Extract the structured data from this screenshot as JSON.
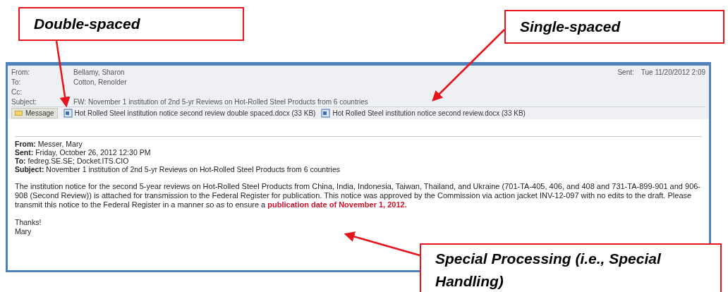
{
  "callouts": [
    {
      "text": "Double-spaced"
    },
    {
      "text": "Single-spaced"
    },
    {
      "text": "Special Processing (i.e., Special Handling)"
    }
  ],
  "email": {
    "header": [
      {
        "label": "From:",
        "value": "Bellamy, Sharon"
      },
      {
        "label": "To:",
        "value": "Cotton, Renolder"
      },
      {
        "label": "Cc:"
      },
      {
        "label": "Subject:",
        "value": "FW: November 1 institution of 2nd 5-yr Reviews on Hot-Rolled Steel Products from 6 countries"
      }
    ],
    "sent": {
      "label": "Sent:",
      "value": "Tue 11/20/2012 2:09"
    },
    "message_tab": "Message",
    "attachments": [
      "Hot Rolled Steel institution notice second review double spaced.docx (33 KB)",
      "Hot Rolled Steel institution notice second review.docx (33 KB)"
    ],
    "forwarded": [
      {
        "label": "From:",
        "value": "Messer, Mary"
      },
      {
        "label": "Sent:",
        "value": "Friday, October 26, 2012 12:30 PM"
      },
      {
        "label": "To:",
        "value": "fedreg.SE.SE; Docket.ITS.CIO"
      },
      {
        "label": "Subject:",
        "value": "November 1 institution of 2nd 5-yr Reviews on Hot-Rolled Steel Products from 6 countries"
      }
    ],
    "body": "The institution notice for the second 5-year reviews on Hot-Rolled Steel Products from China, India, Indonesia, Taiwan, Thailand, and Ukraine (701-TA-405, 406, and 408 and 731-TA-899-901 and 906-908 (Second Review)) is attached for transmission to the Federal Register for publication.  This notice was approved by the Commission via action jacket INV-12-097 with no edits to the draft.  Please transmit this notice to the Federal Register in a manner so as to ensure a **publication date of November 1, 2012.**",
    "closing": [
      "Thanks!",
      "Mary"
    ]
  }
}
